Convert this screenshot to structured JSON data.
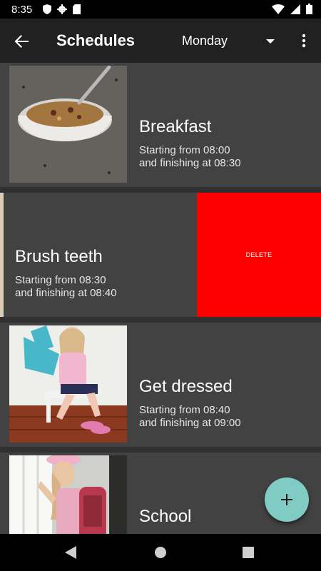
{
  "status_bar": {
    "time": "8:35",
    "left_icons": [
      "shield-icon",
      "gear-icon",
      "sd-card-icon"
    ],
    "right_icons": [
      "wifi-icon",
      "signal-icon",
      "battery-icon"
    ]
  },
  "app_bar": {
    "title": "Schedules",
    "day": "Monday",
    "background": "#212121"
  },
  "schedules": [
    {
      "title": "Breakfast",
      "line1": "Starting from 08:00",
      "line2": "and finishing at 08:30",
      "image": "cereal-bowl-photo"
    },
    {
      "title": "Brush teeth",
      "line1": "Starting from 08:30",
      "line2": "and finishing at 08:40",
      "swiped": true,
      "action_label": "DELETE",
      "action_color": "#ff0000"
    },
    {
      "title": "Get dressed",
      "line1": "Starting from 08:40",
      "line2": "and finishing at 09:00",
      "image": "child-dressing-photo"
    },
    {
      "title": "School",
      "line1": "",
      "line2": "",
      "image": "child-with-backpack-photo"
    }
  ],
  "fab": {
    "icon": "plus-icon",
    "color": "#80cbc4"
  },
  "nav": {
    "icons": [
      "nav-back-icon",
      "nav-home-icon",
      "nav-recents-icon"
    ]
  }
}
